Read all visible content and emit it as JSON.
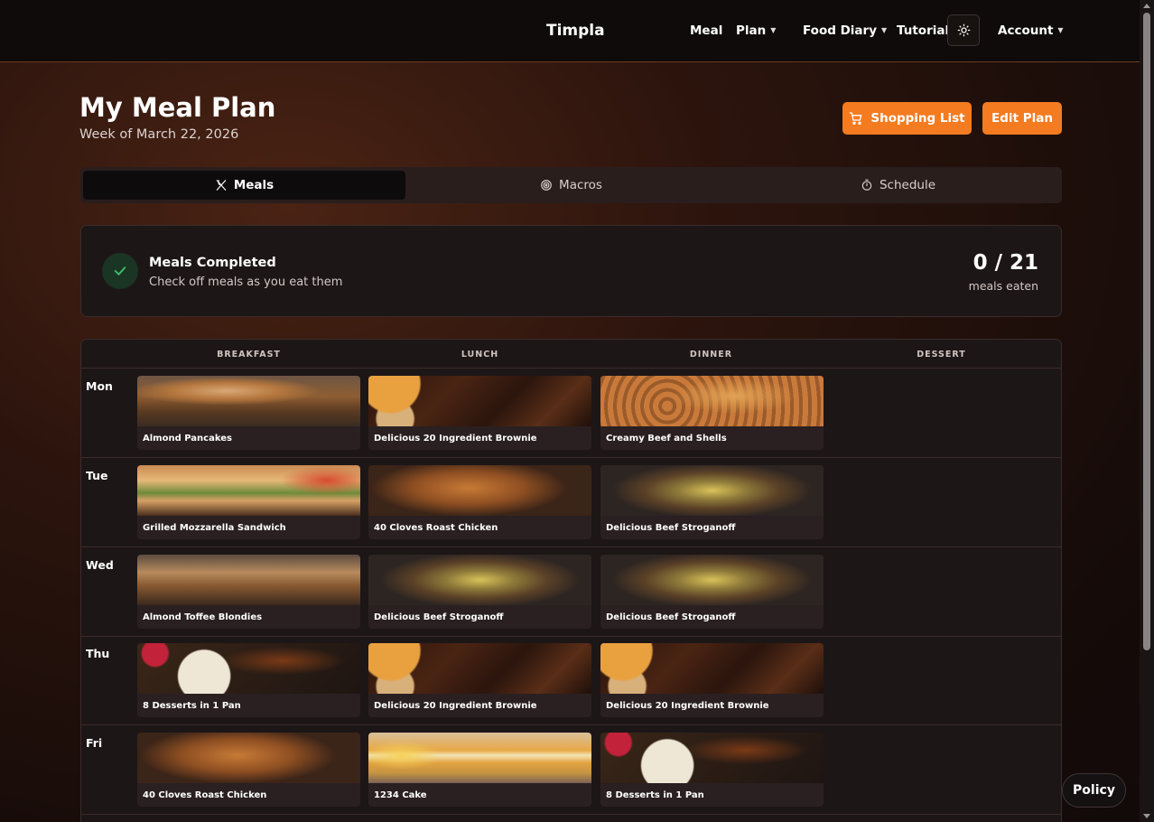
{
  "header": {
    "brand": "Timpla",
    "nav": {
      "meal": "Meal",
      "plan": "Plan",
      "food_diary": "Food Diary",
      "tutorial": "Tutorial",
      "account": "Account"
    },
    "theme_icon": "sun-icon"
  },
  "page": {
    "title": "My Meal Plan",
    "subtitle": "Week of March 22, 2026",
    "shopping_list_label": "Shopping List",
    "edit_plan_label": "Edit Plan"
  },
  "tabs": [
    {
      "label": "Meals",
      "icon": "utensils-icon",
      "active": true
    },
    {
      "label": "Macros",
      "icon": "target-icon",
      "active": false
    },
    {
      "label": "Schedule",
      "icon": "timer-icon",
      "active": false
    }
  ],
  "progress": {
    "title": "Meals Completed",
    "subtitle": "Check off meals as you eat them",
    "count": "0 / 21",
    "label": "meals eaten"
  },
  "grid": {
    "columns": [
      "BREAKFAST",
      "LUNCH",
      "DINNER",
      "DESSERT"
    ],
    "rows": [
      {
        "day": "Mon",
        "meals": [
          "Almond Pancakes",
          "Delicious 20 Ingredient Brownie",
          "Creamy Beef and Shells"
        ]
      },
      {
        "day": "Tue",
        "meals": [
          "Grilled Mozzarella Sandwich",
          "40 Cloves Roast Chicken",
          "Delicious Beef Stroganoff"
        ]
      },
      {
        "day": "Wed",
        "meals": [
          "Almond Toffee Blondies",
          "Delicious Beef Stroganoff",
          "Delicious Beef Stroganoff"
        ]
      },
      {
        "day": "Thu",
        "meals": [
          "8 Desserts in 1 Pan",
          "Delicious 20 Ingredient Brownie",
          "Delicious 20 Ingredient Brownie"
        ]
      },
      {
        "day": "Fri",
        "meals": [
          "40 Cloves Roast Chicken",
          "1234 Cake",
          "8 Desserts in 1 Pan"
        ]
      }
    ]
  },
  "footer": {
    "policy_label": "Policy"
  },
  "colors": {
    "accent": "#f47b20",
    "header_bg": "#0f0b0b",
    "card_bg": "#1d1617",
    "success": "#3fbf6a"
  }
}
